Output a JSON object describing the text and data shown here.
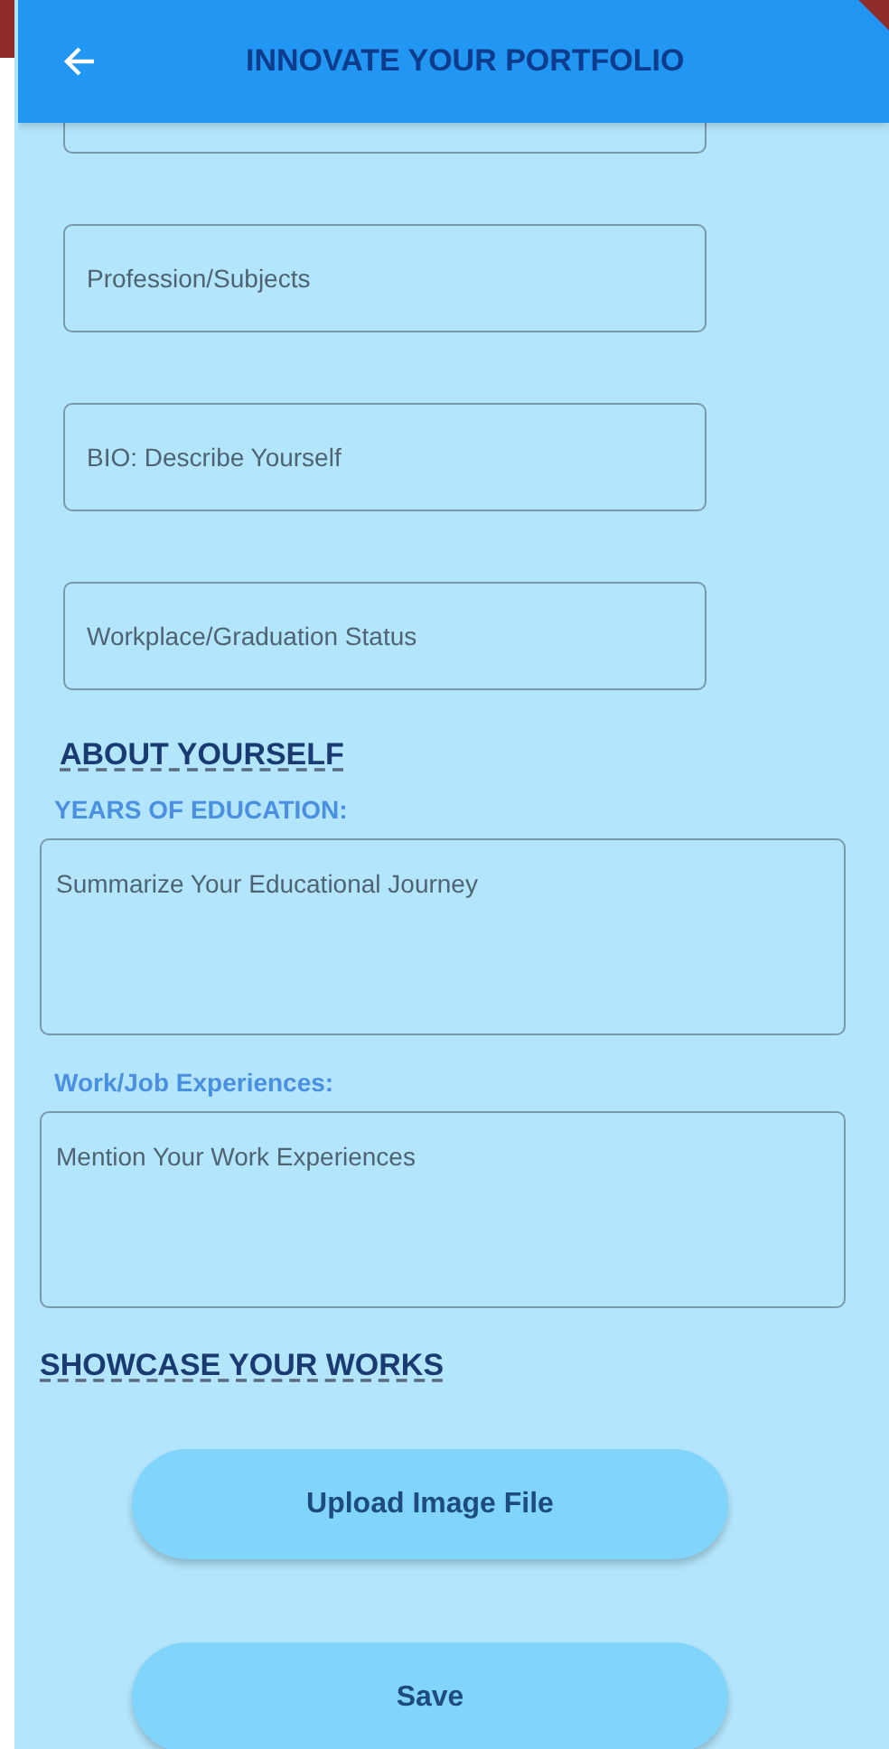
{
  "app_bar": {
    "title": "INNOVATE YOUR PORTFOLIO"
  },
  "profile_fields": [
    {
      "kind": "partial"
    },
    {
      "kind": "full",
      "placeholder": "Profession/Subjects"
    },
    {
      "kind": "full",
      "placeholder": "BIO: Describe Yourself"
    },
    {
      "kind": "full",
      "placeholder": "Workplace/Graduation Status"
    }
  ],
  "about": {
    "heading": "ABOUT YOURSELF",
    "groups": [
      {
        "label": "YEARS OF EDUCATION:",
        "placeholder": "Summarize Your Educational Journey"
      },
      {
        "label": "Work/Job Experiences:",
        "placeholder": "Mention Your Work Experiences"
      }
    ]
  },
  "showcase": {
    "heading": "SHOWCASE YOUR WORKS"
  },
  "buttons": [
    {
      "label": "Upload Image File"
    },
    {
      "label": "Save"
    }
  ]
}
